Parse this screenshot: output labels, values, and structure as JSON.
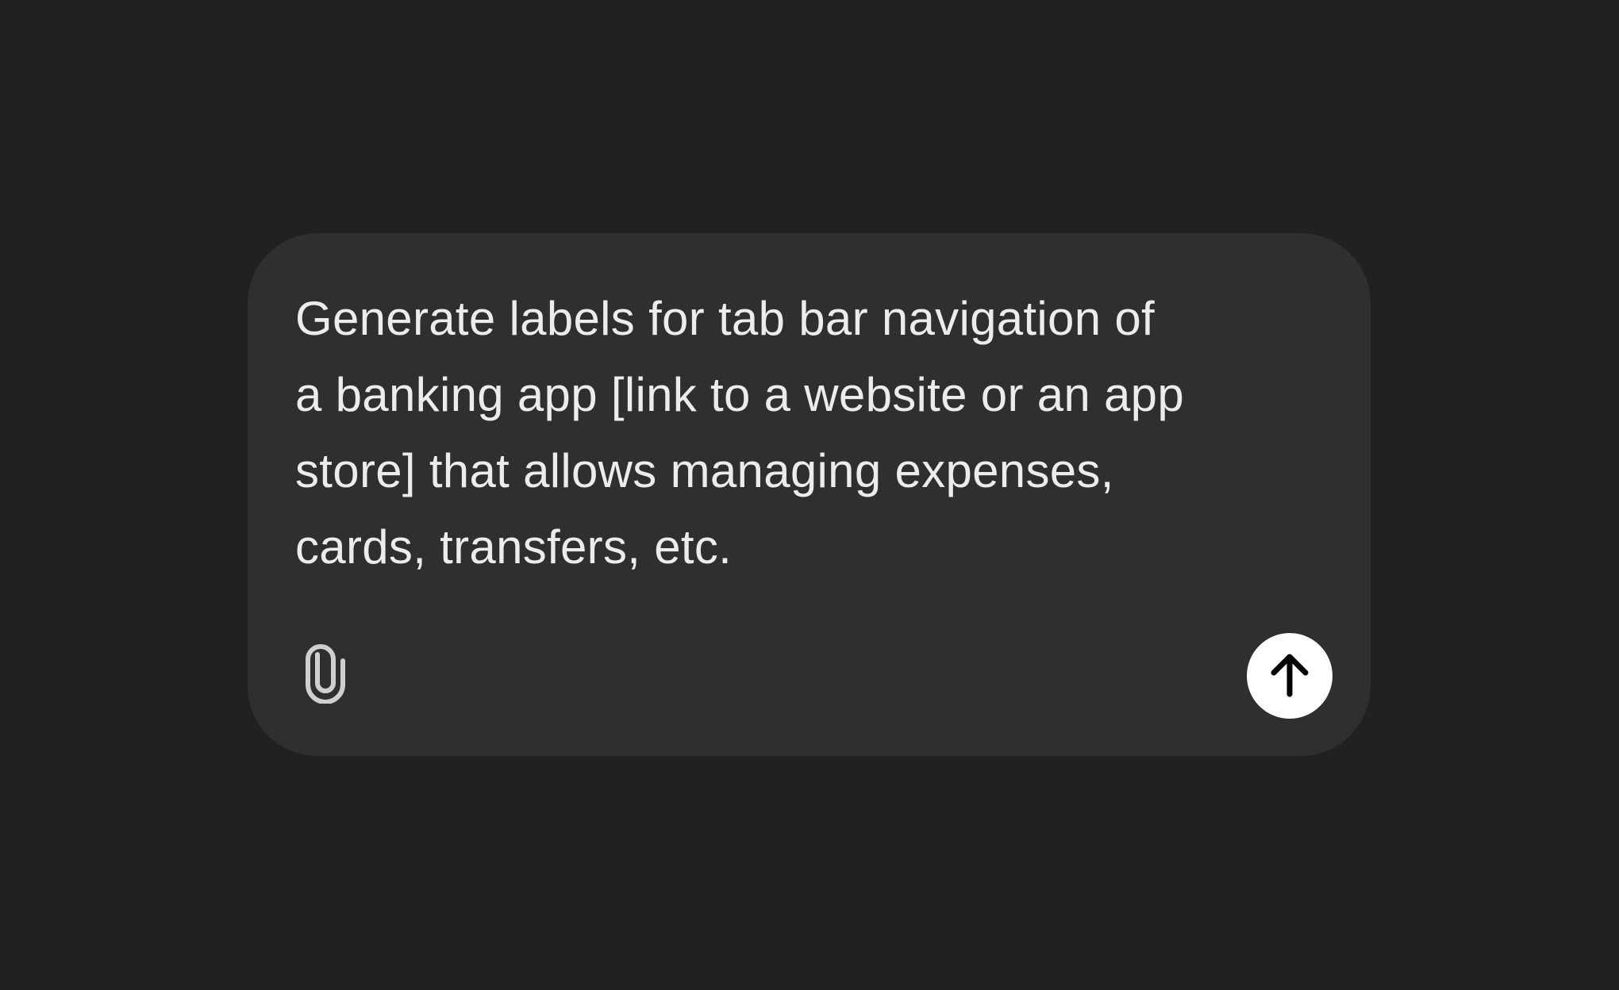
{
  "composer": {
    "prompt_text": "Generate labels for tab bar navigation of\na banking app [link to a website or an app\nstore] that allows managing expenses,\ncards, transfers, etc.",
    "attach_icon": "paperclip-icon",
    "send_icon": "arrow-up-icon"
  },
  "colors": {
    "background": "#212121",
    "composer_background": "#2f2f2f",
    "text": "#ececec",
    "attach_icon": "#cfcfcf",
    "send_button": "#ffffff",
    "send_icon": "#000000"
  }
}
